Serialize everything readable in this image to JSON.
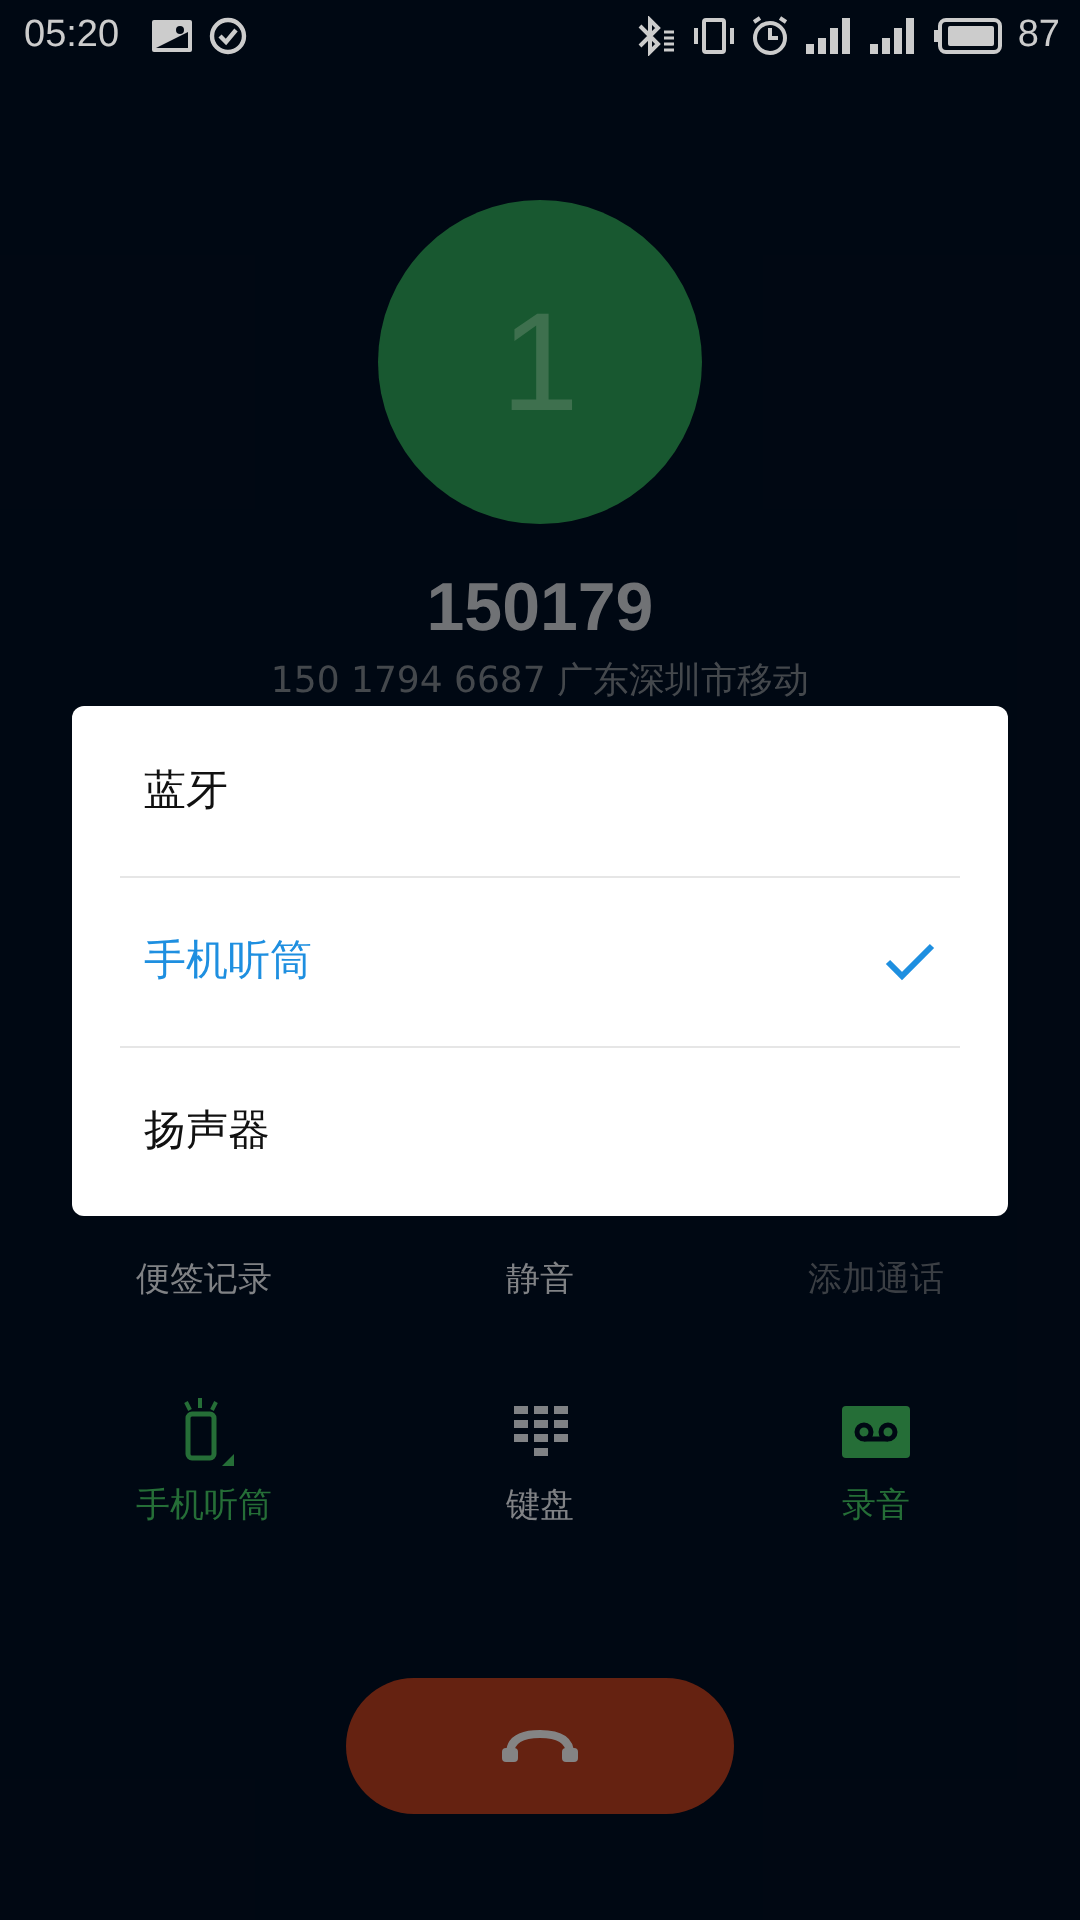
{
  "status_bar": {
    "time": "05:20",
    "battery": "87"
  },
  "caller": {
    "avatar_letter": "1",
    "number": "150179",
    "detail": "150 1794 6687  广东深圳市移动"
  },
  "actions": [
    {
      "label": "便签记录",
      "kind": "note",
      "active": false,
      "disabled": false
    },
    {
      "label": "静音",
      "kind": "mute",
      "active": false,
      "disabled": false
    },
    {
      "label": "添加通话",
      "kind": "add",
      "active": false,
      "disabled": true
    },
    {
      "label": "手机听筒",
      "kind": "earpiece",
      "active": true,
      "disabled": false
    },
    {
      "label": "键盘",
      "kind": "keypad",
      "active": false,
      "disabled": false
    },
    {
      "label": "录音",
      "kind": "record",
      "active": true,
      "disabled": false
    }
  ],
  "audio_menu": {
    "options": [
      {
        "label": "蓝牙",
        "selected": false
      },
      {
        "label": "手机听筒",
        "selected": true
      },
      {
        "label": "扬声器",
        "selected": false
      }
    ]
  }
}
